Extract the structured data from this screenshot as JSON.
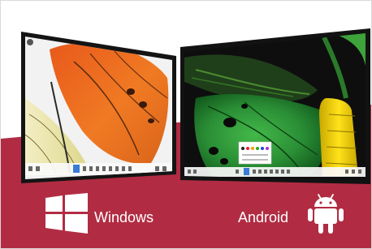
{
  "labels": {
    "windows": "Windows",
    "android": "Android"
  },
  "colors": {
    "brand_band": "#b12c43",
    "monitor_bezel": "#121212",
    "caption_text": "#ffffff"
  },
  "icons": {
    "windows_logo": "windows-logo-icon",
    "android_logo": "android-robot-icon"
  }
}
